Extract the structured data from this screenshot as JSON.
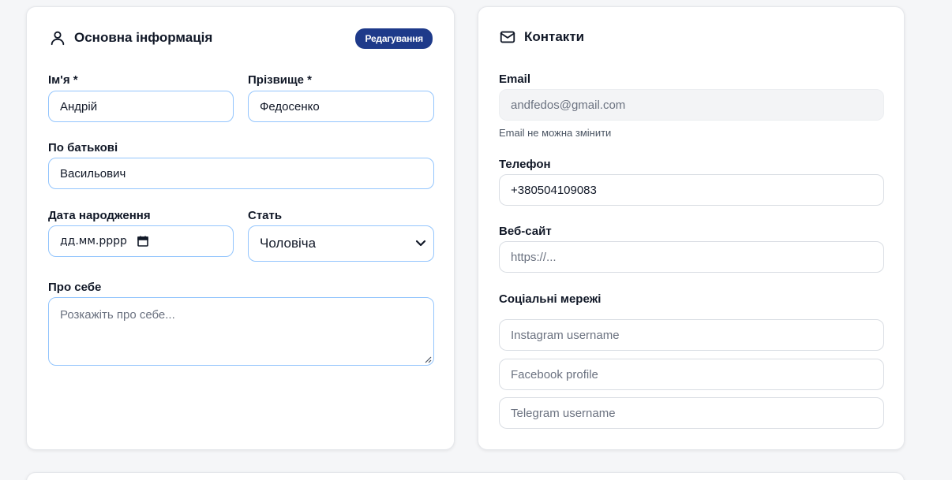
{
  "basic": {
    "title": "Основна інформація",
    "edit_badge": "Редагування",
    "first_name": {
      "label": "Ім'я *",
      "value": "Андрій"
    },
    "last_name": {
      "label": "Прізвище *",
      "value": "Федосенко"
    },
    "patronymic": {
      "label": "По батькові",
      "value": "Васильович"
    },
    "birth_date": {
      "label": "Дата народження",
      "placeholder": "дд.мм.рррр"
    },
    "gender": {
      "label": "Стать",
      "value": "Чоловіча"
    },
    "about": {
      "label": "Про себе",
      "placeholder": "Розкажіть про себе..."
    }
  },
  "contacts": {
    "title": "Контакти",
    "email": {
      "label": "Email",
      "value": "andfedos@gmail.com",
      "hint": "Email не можна змінити"
    },
    "phone": {
      "label": "Телефон",
      "value": "+380504109083"
    },
    "website": {
      "label": "Веб-сайт",
      "placeholder": "https://..."
    },
    "social": {
      "label": "Соціальні мережі",
      "instagram_placeholder": "Instagram username",
      "facebook_placeholder": "Facebook profile",
      "telegram_placeholder": "Telegram username"
    }
  },
  "icons": {
    "user": "user-icon",
    "mail": "mail-icon",
    "calendar": "calendar-icon",
    "chevron": "chevron-down-icon"
  },
  "colors": {
    "accent": "#1e3a8a",
    "focus_border": "#93c5fd",
    "background": "#f5f6f8"
  }
}
